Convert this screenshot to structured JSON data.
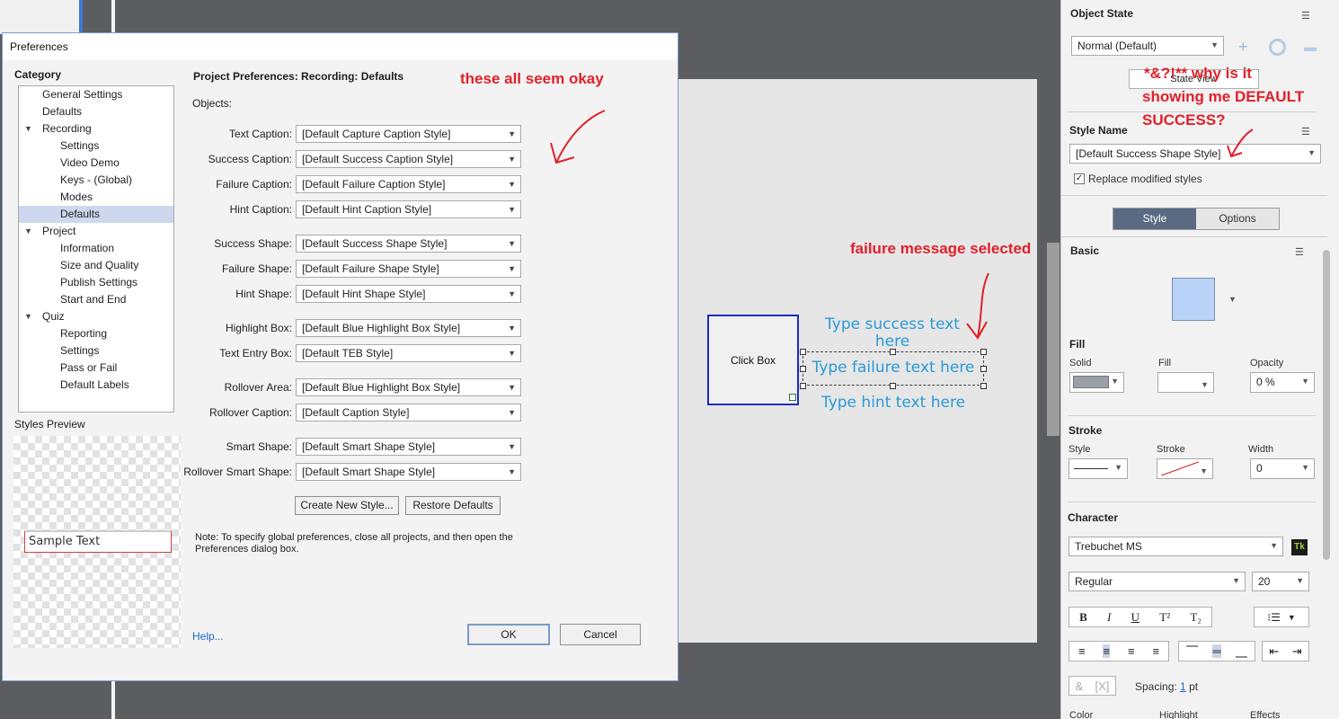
{
  "dialog": {
    "title": "Preferences",
    "category_heading": "Category",
    "tree": [
      {
        "label": "General Settings",
        "level": 1
      },
      {
        "label": "Defaults",
        "level": 1
      },
      {
        "label": "Recording",
        "level": 1,
        "expander": "▼"
      },
      {
        "label": "Settings",
        "level": 2
      },
      {
        "label": "Video Demo",
        "level": 2
      },
      {
        "label": "Keys - (Global)",
        "level": 2
      },
      {
        "label": "Modes",
        "level": 2
      },
      {
        "label": "Defaults",
        "level": 2,
        "selected": true
      },
      {
        "label": "Project",
        "level": 1,
        "expander": "▼"
      },
      {
        "label": "Information",
        "level": 2
      },
      {
        "label": "Size and Quality",
        "level": 2
      },
      {
        "label": "Publish Settings",
        "level": 2
      },
      {
        "label": "Start and End",
        "level": 2
      },
      {
        "label": "Quiz",
        "level": 1,
        "expander": "▼"
      },
      {
        "label": "Reporting",
        "level": 2
      },
      {
        "label": "Settings",
        "level": 2
      },
      {
        "label": "Pass or Fail",
        "level": 2
      },
      {
        "label": "Default Labels",
        "level": 2
      }
    ],
    "styles_preview_label": "Styles Preview",
    "sample_text": "Sample Text",
    "pane_title": "Project Preferences: Recording: Defaults",
    "objects_label": "Objects:",
    "rows": [
      {
        "label": "Text Caption:",
        "value": "[Default Capture Caption Style]"
      },
      {
        "label": "Success Caption:",
        "value": "[Default Success Caption Style]"
      },
      {
        "label": "Failure Caption:",
        "value": "[Default Failure Caption Style]"
      },
      {
        "label": "Hint Caption:",
        "value": "[Default Hint Caption Style]"
      },
      {
        "label": "Success Shape:",
        "value": "[Default Success Shape Style]"
      },
      {
        "label": "Failure Shape:",
        "value": "[Default Failure Shape Style]"
      },
      {
        "label": "Hint Shape:",
        "value": "[Default Hint Shape Style]"
      },
      {
        "label": "Highlight Box:",
        "value": "[Default Blue Highlight Box Style]"
      },
      {
        "label": "Text Entry Box:",
        "value": "[Default TEB Style]"
      },
      {
        "label": "Rollover Area:",
        "value": "[Default Blue Highlight Box Style]"
      },
      {
        "label": "Rollover Caption:",
        "value": "[Default Caption Style]"
      },
      {
        "label": "Smart Shape:",
        "value": "[Default Smart Shape Style]"
      },
      {
        "label": "Rollover Smart Shape:",
        "value": "[Default Smart Shape Style]"
      }
    ],
    "create_style_label": "Create New Style...",
    "restore_defaults_label": "Restore Defaults",
    "note": "Note: To specify global preferences, close all projects, and then open the Preferences dialog box.",
    "help_label": "Help...",
    "ok_label": "OK",
    "cancel_label": "Cancel"
  },
  "canvas": {
    "click_box_label": "Click Box",
    "success_text": "Type success text here",
    "failure_text": "Type failure text here",
    "hint_text": "Type hint text here"
  },
  "annotations": {
    "okay": "these all seem okay",
    "selected": "failure message selected",
    "why_1": "*&?!**  why is it",
    "why_2": "showing me DEFAULT",
    "why_3": "SUCCESS?"
  },
  "properties": {
    "object_state_heading": "Object State",
    "state_value": "Normal (Default)",
    "state_view_label": "State View",
    "style_name_heading": "Style Name",
    "style_name_value": "[Default Success Shape Style]",
    "replace_modified_label": "Replace modified styles",
    "replace_modified_checked": true,
    "tabs": [
      "Style",
      "Options"
    ],
    "basic_heading": "Basic",
    "fill_heading": "Fill",
    "fill_labels": [
      "Solid",
      "Fill",
      "Opacity"
    ],
    "opacity_value": "0 %",
    "stroke_heading": "Stroke",
    "stroke_labels": [
      "Style",
      "Stroke",
      "Width"
    ],
    "width_value": "0",
    "character_heading": "Character",
    "font_value": "Trebuchet MS",
    "font_style_value": "Regular",
    "font_size_value": "20",
    "format_buttons": [
      "B",
      "I",
      "U",
      "T²",
      "T₂"
    ],
    "spacing_label": "Spacing:",
    "spacing_value": "1",
    "spacing_unit": "pt",
    "bottom_labels": [
      "Color",
      "Highlight",
      "Effects"
    ],
    "colors": {
      "swatch": "#b9d3f8",
      "fill_solid": "#9aa0aa",
      "accent": "#596a82"
    }
  }
}
